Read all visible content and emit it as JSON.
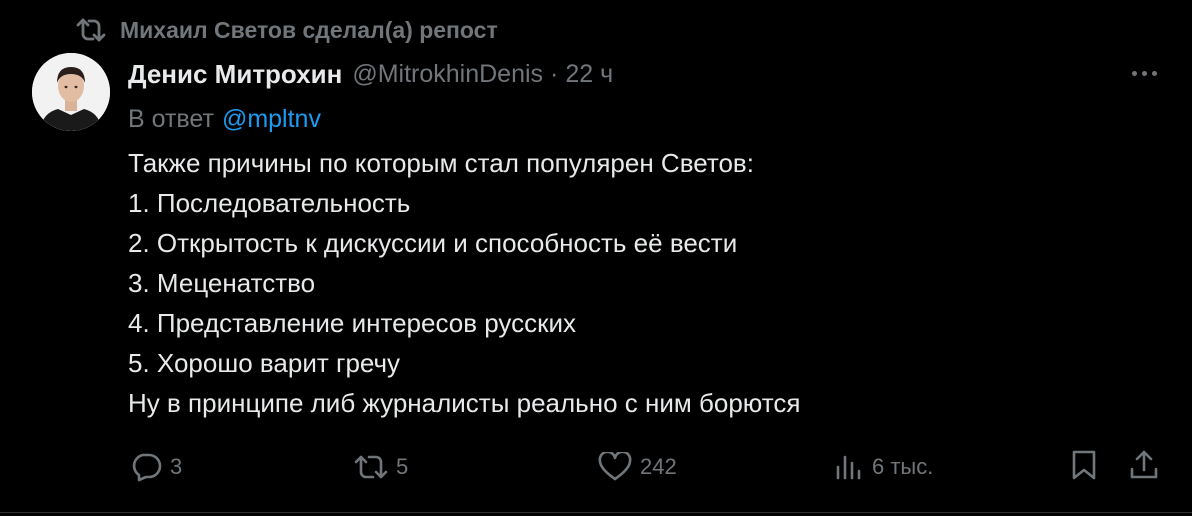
{
  "repost": {
    "label": "Михаил Светов сделал(а) репост",
    "icon": "repost-icon"
  },
  "tweet": {
    "author_name": "Денис Митрохин",
    "handle": "@MitrokhinDenis",
    "separator": "·",
    "time": "22 ч",
    "reply_prefix": "В ответ",
    "reply_to": "@mpltnv",
    "lines": [
      "Также причины по которым стал популярен Светов:",
      "1. Последовательность",
      "2. Открытость к дискуссии и способность её вести",
      "3. Меценатство",
      "4. Представление интересов русских",
      "5. Хорошо варит гречу",
      "Ну в принципе либ журналисты реально с ним борются"
    ]
  },
  "actions": {
    "replies": "3",
    "reposts": "5",
    "likes": "242",
    "views": "6 тыс."
  },
  "colors": {
    "background": "#000000",
    "text": "#e7e9ea",
    "muted": "#71767b",
    "accent": "#1d9bf0"
  }
}
